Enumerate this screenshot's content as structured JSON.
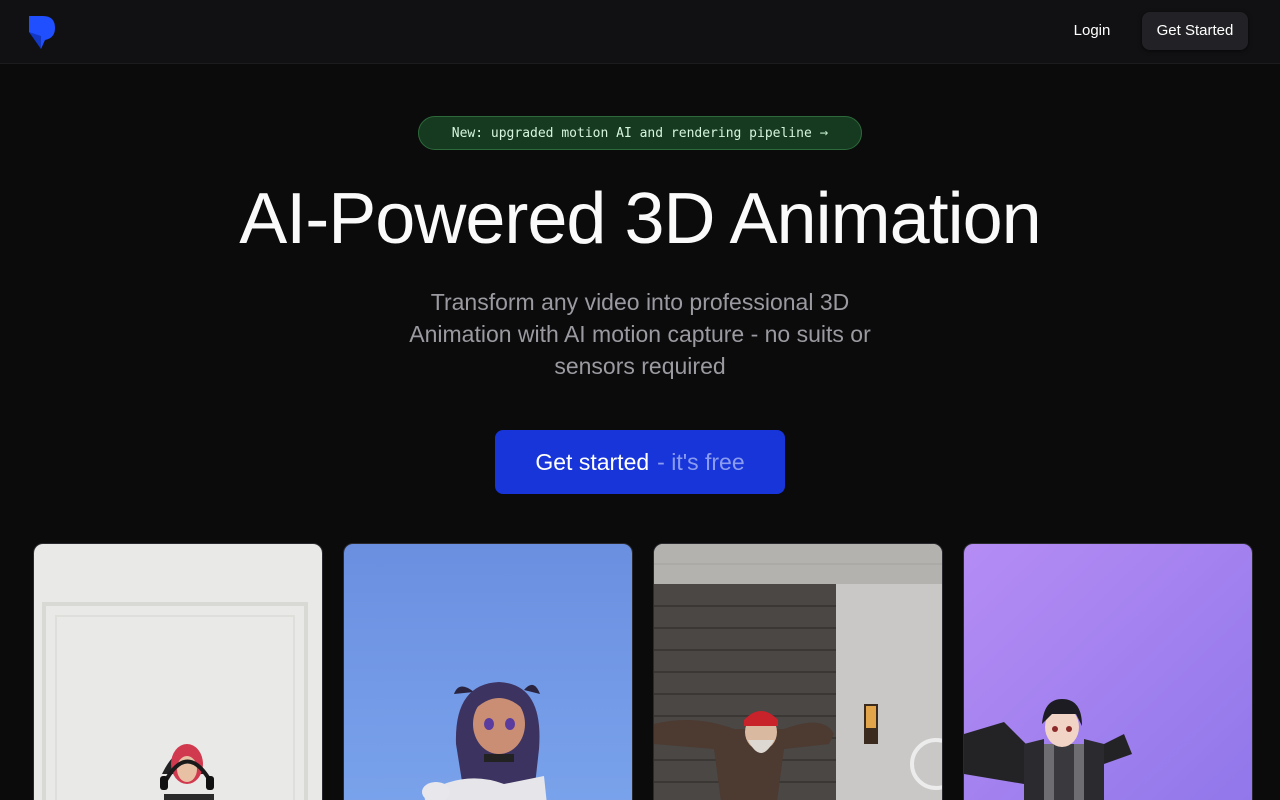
{
  "header": {
    "logo_icon": "brand-logo-icon",
    "login_label": "Login",
    "cta_label": "Get Started"
  },
  "hero": {
    "badge_text": "New: upgraded motion AI and rendering pipeline",
    "badge_icon": "arrow-right-icon",
    "title": "AI-Powered 3D Animation",
    "subtitle": "Transform any video into professional 3D Animation with AI motion capture - no suits or sensors required",
    "cta_main": "Get started",
    "cta_sub": "- it's free"
  },
  "showcase": {
    "cards": [
      {
        "name": "real-dancer-video"
      },
      {
        "name": "anime-avatar-render"
      },
      {
        "name": "bearded-man-video"
      },
      {
        "name": "anime-boy-avatar-render"
      }
    ]
  },
  "colors": {
    "background": "#0b0b0c",
    "accent": "#1735d8",
    "badge_bg": "#153a1f"
  }
}
